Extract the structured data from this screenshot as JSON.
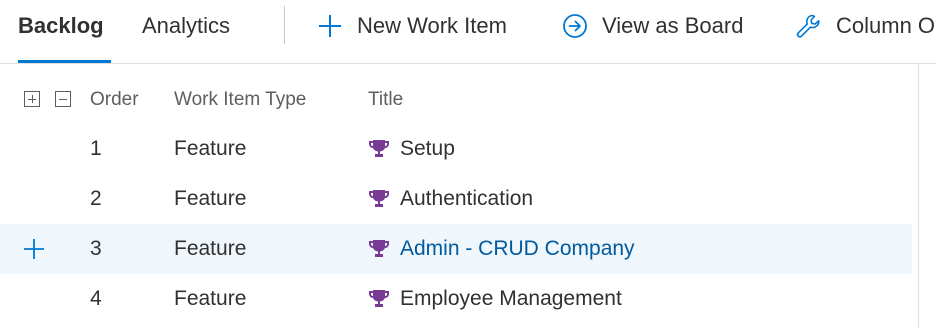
{
  "tabs": [
    {
      "label": "Backlog",
      "active": true
    },
    {
      "label": "Analytics",
      "active": false
    }
  ],
  "commands": {
    "new_work_item": "New Work Item",
    "view_as_board": "View as Board",
    "column_options": "Column O"
  },
  "colors": {
    "accent": "#0078d4",
    "feature_icon": "#773b93",
    "selected_row_bg": "#eff6fc",
    "link": "#005a9e"
  },
  "grid": {
    "columns": {
      "order": "Order",
      "type": "Work Item Type",
      "title": "Title"
    },
    "expand_all_icon": "expand-all-icon",
    "collapse_all_icon": "collapse-all-icon",
    "rows": [
      {
        "order": "1",
        "type": "Feature",
        "title": "Setup",
        "icon": "trophy-icon"
      },
      {
        "order": "2",
        "type": "Feature",
        "title": "Authentication",
        "icon": "trophy-icon"
      },
      {
        "order": "3",
        "type": "Feature",
        "title": "Admin - CRUD Company",
        "icon": "trophy-icon",
        "selected": true
      },
      {
        "order": "4",
        "type": "Feature",
        "title": "Employee Management",
        "icon": "trophy-icon"
      }
    ]
  }
}
